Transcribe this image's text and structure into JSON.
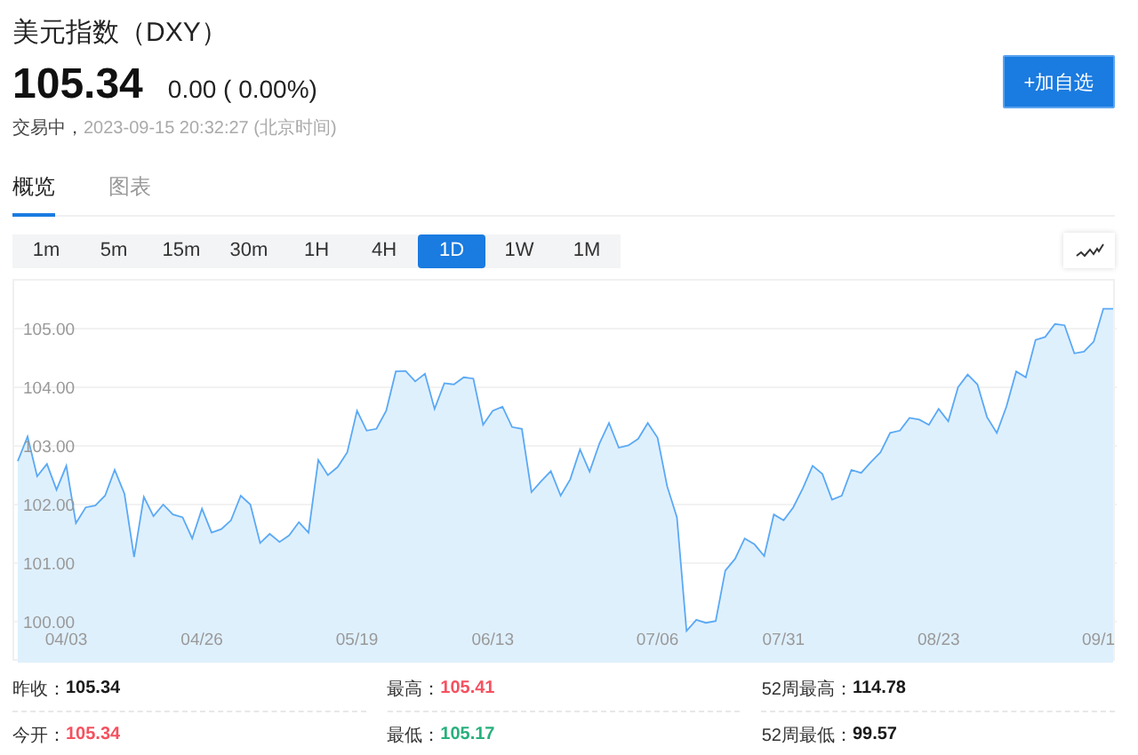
{
  "quote": {
    "title": "美元指数（DXY）",
    "price": "105.34",
    "change": "0.00",
    "change_pct": "( 0.00%)",
    "status": "交易中，",
    "timestamp": "2023-09-15 20:32:27 (北京时间)",
    "add_button": "+加自选"
  },
  "tabs": [
    {
      "label": "概览",
      "selected": true
    },
    {
      "label": "图表",
      "selected": false
    }
  ],
  "ranges": [
    {
      "label": "1m",
      "selected": false
    },
    {
      "label": "5m",
      "selected": false
    },
    {
      "label": "15m",
      "selected": false
    },
    {
      "label": "30m",
      "selected": false
    },
    {
      "label": "1H",
      "selected": false
    },
    {
      "label": "4H",
      "selected": false
    },
    {
      "label": "1D",
      "selected": true
    },
    {
      "label": "1W",
      "selected": false
    },
    {
      "label": "1M",
      "selected": false
    }
  ],
  "chart": {
    "chart_data": {
      "type": "area",
      "grid": true,
      "ylim": [
        99.3,
        105.82
      ],
      "yticks": [
        {
          "value": 100,
          "label": "100.00"
        },
        {
          "value": 101,
          "label": "101.00"
        },
        {
          "value": 102,
          "label": "102.00"
        },
        {
          "value": 103,
          "label": "103.00"
        },
        {
          "value": 104,
          "label": "104.00"
        },
        {
          "value": 105,
          "label": "105.00"
        }
      ],
      "categories": [
        null,
        null,
        null,
        null,
        null,
        "04/03",
        null,
        null,
        null,
        null,
        null,
        null,
        null,
        null,
        null,
        null,
        null,
        null,
        null,
        "04/26",
        null,
        null,
        null,
        null,
        null,
        null,
        null,
        null,
        null,
        null,
        null,
        null,
        null,
        null,
        null,
        "05/19",
        null,
        null,
        null,
        null,
        null,
        null,
        null,
        null,
        null,
        null,
        null,
        null,
        null,
        "06/13",
        null,
        null,
        null,
        null,
        null,
        null,
        null,
        null,
        null,
        null,
        null,
        null,
        null,
        null,
        null,
        null,
        "07/06",
        null,
        null,
        null,
        null,
        null,
        null,
        null,
        null,
        null,
        null,
        null,
        null,
        "07/31",
        null,
        null,
        null,
        null,
        null,
        null,
        null,
        null,
        null,
        null,
        null,
        null,
        null,
        null,
        null,
        "08/23",
        null,
        null,
        null,
        null,
        null,
        null,
        null,
        null,
        null,
        null,
        null,
        null,
        null,
        null,
        null,
        null,
        "09/1",
        null
      ],
      "series": [
        {
          "color": "#5aa9f5",
          "values": [
            102.74,
            103.16,
            102.48,
            102.69,
            102.25,
            102.66,
            101.68,
            101.95,
            101.98,
            102.15,
            102.59,
            102.18,
            101.1,
            102.13,
            101.8,
            102,
            101.83,
            101.78,
            101.42,
            101.93,
            101.52,
            101.58,
            101.73,
            102.15,
            102,
            101.34,
            101.5,
            101.36,
            101.47,
            101.7,
            101.52,
            102.76,
            102.5,
            102.64,
            102.89,
            103.6,
            103.26,
            103.29,
            103.6,
            104.27,
            104.28,
            104.1,
            104.23,
            103.63,
            104.07,
            104.05,
            104.17,
            104.15,
            103.36,
            103.6,
            103.67,
            103.32,
            103.29,
            102.21,
            102.4,
            102.57,
            102.15,
            102.43,
            102.94,
            102.56,
            103.04,
            103.39,
            102.97,
            103.01,
            103.12,
            103.39,
            103.14,
            102.31,
            101.78,
            99.84,
            100.03,
            99.98,
            100.01,
            100.87,
            101.07,
            101.42,
            101.32,
            101.12,
            101.83,
            101.73,
            101.95,
            102.28,
            102.66,
            102.52,
            102.08,
            102.15,
            102.59,
            102.54,
            102.72,
            102.89,
            103.22,
            103.26,
            103.48,
            103.45,
            103.36,
            103.63,
            103.42,
            104,
            104.22,
            104.05,
            103.49,
            103.22,
            103.67,
            104.27,
            104.17,
            104.81,
            104.86,
            105.08,
            105.06,
            104.58,
            104.61,
            104.78,
            105.34,
            105.34
          ]
        }
      ]
    }
  },
  "stats": [
    {
      "label": "昨收：",
      "value": "105.34",
      "color": "#1a1a1a"
    },
    {
      "label": "最高：",
      "value": "105.41",
      "color": "#f5515f"
    },
    {
      "label": "52周最高：",
      "value": "114.78",
      "color": "#1a1a1a"
    },
    {
      "label": "今开：",
      "value": "105.34",
      "color": "#f5515f"
    },
    {
      "label": "最低：",
      "value": "105.17",
      "color": "#27b07d"
    },
    {
      "label": "52周最低：",
      "value": "99.57",
      "color": "#1a1a1a"
    }
  ]
}
